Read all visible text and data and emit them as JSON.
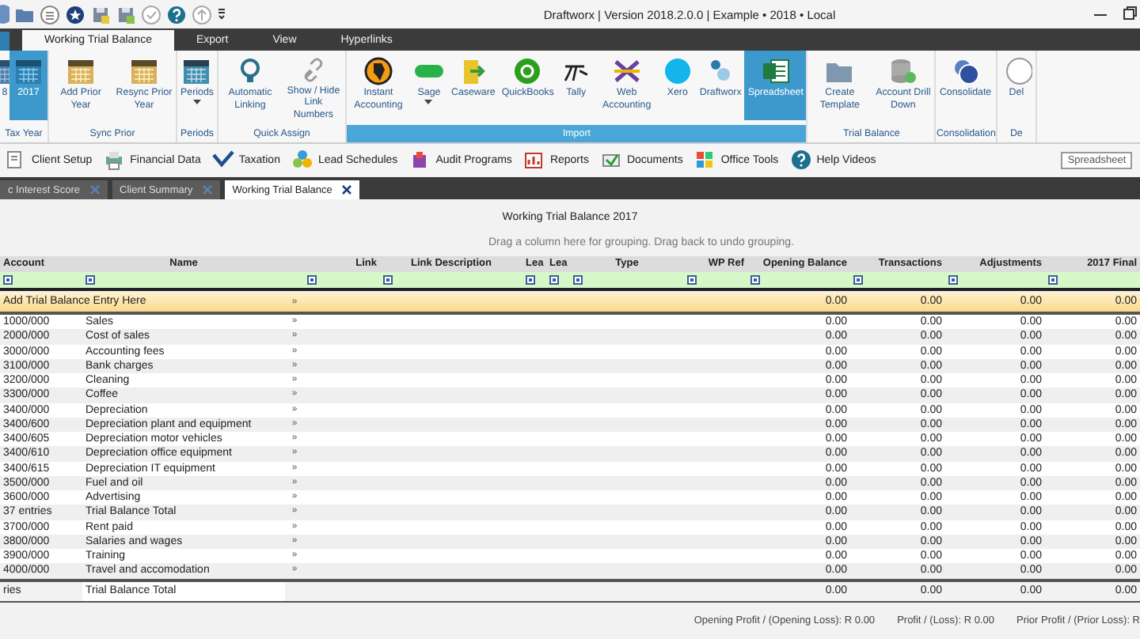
{
  "window": {
    "title": "Draftworx | Version 2018.2.0.0 | Example • 2018 • Local"
  },
  "ribbon_tabs": [
    {
      "label": "Working Trial Balance",
      "selected": true
    },
    {
      "label": "Export",
      "selected": false
    },
    {
      "label": "View",
      "selected": false
    },
    {
      "label": "Hyperlinks",
      "selected": false
    }
  ],
  "ribbon_groups": [
    {
      "label": "Tax Year",
      "highlighted": false,
      "items": [
        {
          "label": "8",
          "selected": false,
          "dropdown": false
        },
        {
          "label": "2017",
          "selected": true,
          "dropdown": false
        }
      ]
    },
    {
      "label": "Sync Prior",
      "highlighted": false,
      "items": [
        {
          "label": "Add Prior Year",
          "selected": false,
          "dropdown": false
        },
        {
          "label": "Resync Prior Year",
          "selected": false,
          "dropdown": false
        }
      ]
    },
    {
      "label": "Periods",
      "highlighted": false,
      "items": [
        {
          "label": "Periods",
          "selected": false,
          "dropdown": true
        }
      ]
    },
    {
      "label": "Quick Assign",
      "highlighted": false,
      "items": [
        {
          "label": "Automatic Linking",
          "selected": false,
          "dropdown": false
        },
        {
          "label": "Show / Hide Link Numbers",
          "selected": false,
          "dropdown": false
        }
      ]
    },
    {
      "label": "Import",
      "highlighted": true,
      "items": [
        {
          "label": "Instant Accounting",
          "selected": false,
          "dropdown": false
        },
        {
          "label": "Sage",
          "selected": false,
          "dropdown": true
        },
        {
          "label": "Caseware",
          "selected": false,
          "dropdown": false
        },
        {
          "label": "QuickBooks",
          "selected": false,
          "dropdown": false
        },
        {
          "label": "Tally",
          "selected": false,
          "dropdown": false
        },
        {
          "label": "Web Accounting",
          "selected": false,
          "dropdown": false
        },
        {
          "label": "Xero",
          "selected": false,
          "dropdown": false
        },
        {
          "label": "Draftworx",
          "selected": false,
          "dropdown": false
        },
        {
          "label": "Spreadsheet",
          "selected": true,
          "dropdown": false
        }
      ]
    },
    {
      "label": "Trial Balance",
      "highlighted": false,
      "items": [
        {
          "label": "Create Template",
          "selected": false,
          "dropdown": false
        },
        {
          "label": "Account Drill Down",
          "selected": false,
          "dropdown": false
        }
      ]
    },
    {
      "label": "Consolidation",
      "highlighted": false,
      "items": [
        {
          "label": "Consolidate",
          "selected": false,
          "dropdown": false
        }
      ]
    },
    {
      "label": "De",
      "highlighted": false,
      "items": [
        {
          "label": "Del",
          "selected": false,
          "dropdown": false
        }
      ]
    }
  ],
  "toolbar": {
    "items": [
      "Client Setup",
      "Financial Data",
      "Taxation",
      "Lead Schedules",
      "Audit Programs",
      "Reports",
      "Documents",
      "Office Tools",
      "Help Videos"
    ],
    "tool_label": "Spreadsheet"
  },
  "document_tabs": [
    {
      "label": "c Interest Score",
      "selected": false
    },
    {
      "label": "Client Summary",
      "selected": false
    },
    {
      "label": "Working Trial Balance",
      "selected": true
    }
  ],
  "grid": {
    "title": "Working Trial Balance 2017",
    "group_hint": "Drag a column here for grouping. Drag back to undo grouping.",
    "columns": [
      "Account",
      "Name",
      "",
      "Link",
      "Link Description",
      "Lea",
      "Lea",
      "Type",
      "WP Ref",
      "Opening Balance",
      "Transactions",
      "Adjustments",
      "2017 Final"
    ],
    "new_row": {
      "label": "Add Trial Balance Entry Here",
      "link": "»",
      "values": [
        "0.00",
        "0.00",
        "0.00",
        "0.00"
      ]
    },
    "rows": [
      {
        "account": "1000/000",
        "name": "Sales",
        "link": "»",
        "values": [
          "0.00",
          "0.00",
          "0.00",
          "0.00"
        ]
      },
      {
        "account": "2000/000",
        "name": "Cost of sales",
        "link": "»",
        "values": [
          "0.00",
          "0.00",
          "0.00",
          "0.00"
        ]
      },
      {
        "account": "3000/000",
        "name": "Accounting fees",
        "link": "»",
        "values": [
          "0.00",
          "0.00",
          "0.00",
          "0.00"
        ]
      },
      {
        "account": "3100/000",
        "name": "Bank charges",
        "link": "»",
        "values": [
          "0.00",
          "0.00",
          "0.00",
          "0.00"
        ]
      },
      {
        "account": "3200/000",
        "name": "Cleaning",
        "link": "»",
        "values": [
          "0.00",
          "0.00",
          "0.00",
          "0.00"
        ]
      },
      {
        "account": "3300/000",
        "name": "Coffee",
        "link": "»",
        "values": [
          "0.00",
          "0.00",
          "0.00",
          "0.00"
        ]
      },
      {
        "account": "3400/000",
        "name": "Depreciation",
        "link": "»",
        "values": [
          "0.00",
          "0.00",
          "0.00",
          "0.00"
        ]
      },
      {
        "account": "3400/600",
        "name": "Depreciation plant and equipment",
        "link": "»",
        "values": [
          "0.00",
          "0.00",
          "0.00",
          "0.00"
        ]
      },
      {
        "account": "3400/605",
        "name": "Depreciation motor vehicles",
        "link": "»",
        "values": [
          "0.00",
          "0.00",
          "0.00",
          "0.00"
        ]
      },
      {
        "account": "3400/610",
        "name": "Depreciation office equipment",
        "link": "»",
        "values": [
          "0.00",
          "0.00",
          "0.00",
          "0.00"
        ]
      },
      {
        "account": "3400/615",
        "name": "Depreciation IT equipment",
        "link": "»",
        "values": [
          "0.00",
          "0.00",
          "0.00",
          "0.00"
        ]
      },
      {
        "account": "3500/000",
        "name": "Fuel and oil",
        "link": "»",
        "values": [
          "0.00",
          "0.00",
          "0.00",
          "0.00"
        ]
      },
      {
        "account": "3600/000",
        "name": "Advertising",
        "link": "»",
        "values": [
          "0.00",
          "0.00",
          "0.00",
          "0.00"
        ]
      },
      {
        "account": "37 entries",
        "name": "Trial Balance Total",
        "link": "»",
        "values": [
          "0.00",
          "0.00",
          "0.00",
          "0.00"
        ]
      },
      {
        "account": "3700/000",
        "name": "Rent paid",
        "link": "»",
        "values": [
          "0.00",
          "0.00",
          "0.00",
          "0.00"
        ]
      },
      {
        "account": "3800/000",
        "name": "Salaries and wages",
        "link": "»",
        "values": [
          "0.00",
          "0.00",
          "0.00",
          "0.00"
        ]
      },
      {
        "account": "3900/000",
        "name": "Training",
        "link": "»",
        "values": [
          "0.00",
          "0.00",
          "0.00",
          "0.00"
        ]
      },
      {
        "account": "4000/000",
        "name": "Travel and accomodation",
        "link": "»",
        "values": [
          "0.00",
          "0.00",
          "0.00",
          "0.00"
        ]
      }
    ],
    "total": {
      "account": "ries",
      "name": "Trial Balance Total",
      "values": [
        "0.00",
        "0.00",
        "0.00",
        "0.00"
      ]
    }
  },
  "status_bar": [
    "Opening Profit / (Opening Loss): R 0.00",
    "Profit / (Loss): R 0.00",
    "Prior Profit / (Prior Loss): R"
  ]
}
